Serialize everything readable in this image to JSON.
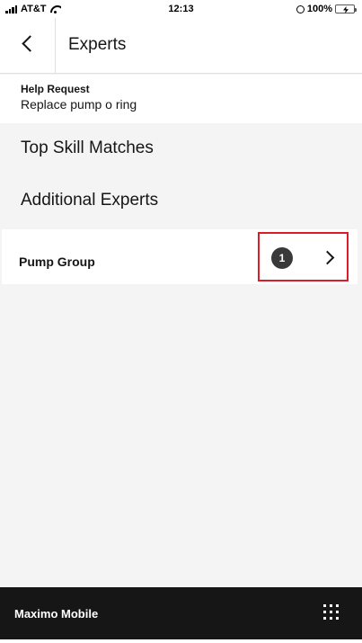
{
  "status_bar": {
    "carrier": "AT&T",
    "time": "12:13",
    "battery": "100%"
  },
  "header": {
    "title": "Experts"
  },
  "help_request": {
    "label": "Help Request",
    "value": "Replace pump o ring"
  },
  "sections": {
    "top_skill_matches": "Top Skill Matches",
    "additional_experts": "Additional Experts"
  },
  "group": {
    "name": "Pump Group",
    "count": "1"
  },
  "bottom_bar": {
    "app_name": "Maximo Mobile"
  },
  "colors": {
    "highlight": "#da1e28",
    "bottom_bar": "#161616",
    "badge": "#393939",
    "battery_fill": "#4cd964"
  }
}
